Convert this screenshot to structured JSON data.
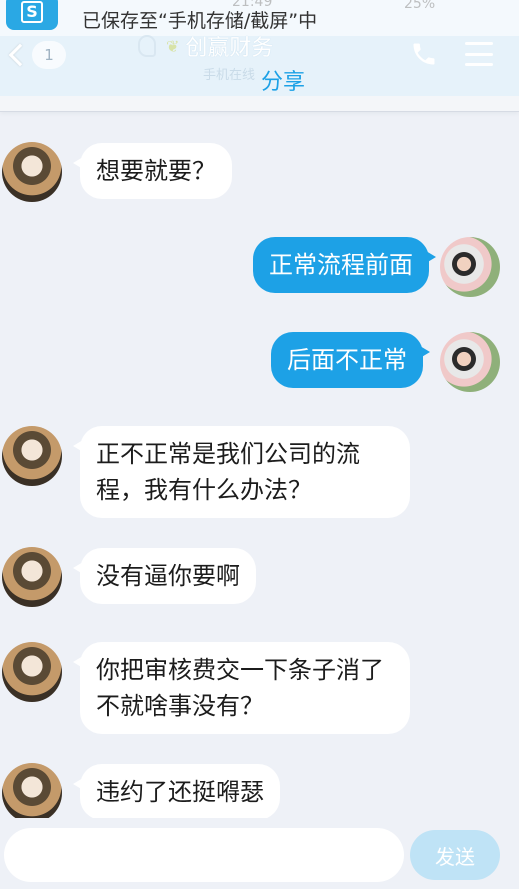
{
  "status_bar": {
    "time": "21:49",
    "battery": "25%"
  },
  "toast": {
    "app_badge": "S",
    "message": "已保存至“手机存储/截屏”中"
  },
  "header": {
    "back_badge": "1",
    "title": "创赢财务",
    "subtitle": "手机在线",
    "share_label": "分享"
  },
  "messages": [
    {
      "side": "in",
      "text": "想要就要？"
    },
    {
      "side": "out",
      "text": "正常流程前面"
    },
    {
      "side": "out",
      "text": "后面不正常"
    },
    {
      "side": "in",
      "text": "正不正常是我们公司的流程，我有什么办法？"
    },
    {
      "side": "in",
      "text": "没有逼你要啊"
    },
    {
      "side": "in",
      "text": "你把审核费交一下条子消了不就啥事没有？"
    },
    {
      "side": "in",
      "text": "违约了还挺嘚瑟"
    }
  ],
  "composer": {
    "placeholder": "",
    "send_label": "发送"
  }
}
